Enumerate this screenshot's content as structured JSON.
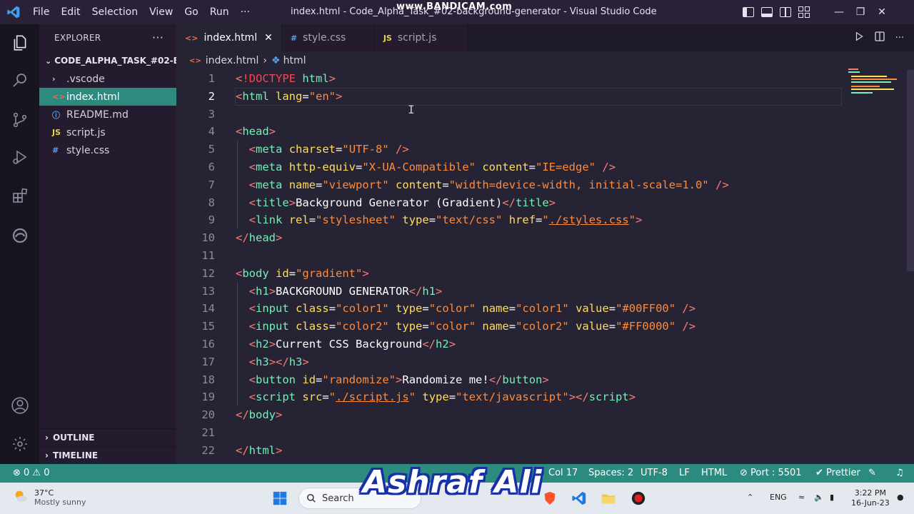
{
  "window": {
    "title": "index.html - Code_Alpha_Task_#02-background-generator - Visual Studio Code",
    "menu": [
      "File",
      "Edit",
      "Selection",
      "View",
      "Go",
      "Run",
      "···"
    ],
    "overlay_text": "www.BANDICAM.com"
  },
  "sidebar": {
    "header": "EXPLORER",
    "project": "CODE_ALPHA_TASK_#02-B...",
    "items": [
      {
        "label": ".vscode",
        "icon": "chevron-right-icon",
        "glyph": "›",
        "color": "#d6d3dc"
      },
      {
        "label": "index.html",
        "icon": "html-file-icon",
        "glyph": "<>",
        "color": "#e8734a"
      },
      {
        "label": "README.md",
        "icon": "info-icon",
        "glyph": "ⓘ",
        "color": "#5aa4e6"
      },
      {
        "label": "script.js",
        "icon": "js-file-icon",
        "glyph": "JS",
        "color": "#e8d44d"
      },
      {
        "label": "style.css",
        "icon": "css-file-icon",
        "glyph": "#",
        "color": "#5aa4e6"
      }
    ],
    "outline": "OUTLINE",
    "timeline": "TIMELINE"
  },
  "tabs": [
    {
      "label": "index.html",
      "icon_glyph": "<>",
      "icon_color": "#e8734a",
      "close": "✕"
    },
    {
      "label": "style.css",
      "icon_glyph": "#",
      "icon_color": "#5aa4e6"
    },
    {
      "label": "script.js",
      "icon_glyph": "JS",
      "icon_color": "#e8d44d"
    }
  ],
  "breadcrumb": {
    "file": "index.html",
    "separator": "›",
    "node": "html"
  },
  "editor": {
    "current_line": 2,
    "lines": [
      {
        "n": "1",
        "tokens": [
          [
            "br",
            "<"
          ],
          [
            "doc",
            "!DOCTYPE"
          ],
          [
            "txt",
            " "
          ],
          [
            "tag",
            "html"
          ],
          [
            "br",
            ">"
          ]
        ]
      },
      {
        "n": "2",
        "tokens": [
          [
            "br",
            "<"
          ],
          [
            "tag",
            "html"
          ],
          [
            "txt",
            " "
          ],
          [
            "attr",
            "lang"
          ],
          [
            "txt",
            "="
          ],
          [
            "str",
            "\"en\""
          ],
          [
            "br",
            ">"
          ]
        ]
      },
      {
        "n": "3",
        "tokens": []
      },
      {
        "n": "4",
        "tokens": [
          [
            "br",
            "<"
          ],
          [
            "tag",
            "head"
          ],
          [
            "br",
            ">"
          ]
        ]
      },
      {
        "n": "5",
        "tokens": [
          [
            "txt",
            "  "
          ],
          [
            "br",
            "<"
          ],
          [
            "tag",
            "meta"
          ],
          [
            "txt",
            " "
          ],
          [
            "attr",
            "charset"
          ],
          [
            "txt",
            "="
          ],
          [
            "str",
            "\"UTF-8\""
          ],
          [
            "txt",
            " "
          ],
          [
            "br",
            "/>"
          ]
        ]
      },
      {
        "n": "6",
        "tokens": [
          [
            "txt",
            "  "
          ],
          [
            "br",
            "<"
          ],
          [
            "tag",
            "meta"
          ],
          [
            "txt",
            " "
          ],
          [
            "attr",
            "http-equiv"
          ],
          [
            "txt",
            "="
          ],
          [
            "str",
            "\"X-UA-Compatible\""
          ],
          [
            "txt",
            " "
          ],
          [
            "attr",
            "content"
          ],
          [
            "txt",
            "="
          ],
          [
            "str",
            "\"IE=edge\""
          ],
          [
            "txt",
            " "
          ],
          [
            "br",
            "/>"
          ]
        ]
      },
      {
        "n": "7",
        "tokens": [
          [
            "txt",
            "  "
          ],
          [
            "br",
            "<"
          ],
          [
            "tag",
            "meta"
          ],
          [
            "txt",
            " "
          ],
          [
            "attr",
            "name"
          ],
          [
            "txt",
            "="
          ],
          [
            "str",
            "\"viewport\""
          ],
          [
            "txt",
            " "
          ],
          [
            "attr",
            "content"
          ],
          [
            "txt",
            "="
          ],
          [
            "str",
            "\"width=device-width, initial-scale=1.0\""
          ],
          [
            "txt",
            " "
          ],
          [
            "br",
            "/>"
          ]
        ]
      },
      {
        "n": "8",
        "tokens": [
          [
            "txt",
            "  "
          ],
          [
            "br",
            "<"
          ],
          [
            "tag",
            "title"
          ],
          [
            "br",
            ">"
          ],
          [
            "txt",
            "Background Generator (Gradient)"
          ],
          [
            "br",
            "</"
          ],
          [
            "tag",
            "title"
          ],
          [
            "br",
            ">"
          ]
        ]
      },
      {
        "n": "9",
        "tokens": [
          [
            "txt",
            "  "
          ],
          [
            "br",
            "<"
          ],
          [
            "tag",
            "link"
          ],
          [
            "txt",
            " "
          ],
          [
            "attr",
            "rel"
          ],
          [
            "txt",
            "="
          ],
          [
            "str",
            "\"stylesheet\""
          ],
          [
            "txt",
            " "
          ],
          [
            "attr",
            "type"
          ],
          [
            "txt",
            "="
          ],
          [
            "str",
            "\"text/css\""
          ],
          [
            "txt",
            " "
          ],
          [
            "attr",
            "href"
          ],
          [
            "txt",
            "="
          ],
          [
            "str",
            "\""
          ],
          [
            "stru",
            "./styles.css"
          ],
          [
            "str",
            "\""
          ],
          [
            "br",
            ">"
          ]
        ]
      },
      {
        "n": "10",
        "tokens": [
          [
            "br",
            "</"
          ],
          [
            "tag",
            "head"
          ],
          [
            "br",
            ">"
          ]
        ]
      },
      {
        "n": "11",
        "tokens": []
      },
      {
        "n": "12",
        "tokens": [
          [
            "br",
            "<"
          ],
          [
            "tag",
            "body"
          ],
          [
            "txt",
            " "
          ],
          [
            "attr",
            "id"
          ],
          [
            "txt",
            "="
          ],
          [
            "str",
            "\"gradient\""
          ],
          [
            "br",
            ">"
          ]
        ]
      },
      {
        "n": "13",
        "tokens": [
          [
            "txt",
            "  "
          ],
          [
            "br",
            "<"
          ],
          [
            "tag",
            "h1"
          ],
          [
            "br",
            ">"
          ],
          [
            "txt",
            "BACKGROUND GENERATOR"
          ],
          [
            "br",
            "</"
          ],
          [
            "tag",
            "h1"
          ],
          [
            "br",
            ">"
          ]
        ]
      },
      {
        "n": "14",
        "tokens": [
          [
            "txt",
            "  "
          ],
          [
            "br",
            "<"
          ],
          [
            "tag",
            "input"
          ],
          [
            "txt",
            " "
          ],
          [
            "attr",
            "class"
          ],
          [
            "txt",
            "="
          ],
          [
            "str",
            "\"color1\""
          ],
          [
            "txt",
            " "
          ],
          [
            "attr",
            "type"
          ],
          [
            "txt",
            "="
          ],
          [
            "str",
            "\"color\""
          ],
          [
            "txt",
            " "
          ],
          [
            "attr",
            "name"
          ],
          [
            "txt",
            "="
          ],
          [
            "str",
            "\"color1\""
          ],
          [
            "txt",
            " "
          ],
          [
            "attr",
            "value"
          ],
          [
            "txt",
            "="
          ],
          [
            "str",
            "\"#00FF00\""
          ],
          [
            "txt",
            " "
          ],
          [
            "br",
            "/>"
          ]
        ]
      },
      {
        "n": "15",
        "tokens": [
          [
            "txt",
            "  "
          ],
          [
            "br",
            "<"
          ],
          [
            "tag",
            "input"
          ],
          [
            "txt",
            " "
          ],
          [
            "attr",
            "class"
          ],
          [
            "txt",
            "="
          ],
          [
            "str",
            "\"color2\""
          ],
          [
            "txt",
            " "
          ],
          [
            "attr",
            "type"
          ],
          [
            "txt",
            "="
          ],
          [
            "str",
            "\"color\""
          ],
          [
            "txt",
            " "
          ],
          [
            "attr",
            "name"
          ],
          [
            "txt",
            "="
          ],
          [
            "str",
            "\"color2\""
          ],
          [
            "txt",
            " "
          ],
          [
            "attr",
            "value"
          ],
          [
            "txt",
            "="
          ],
          [
            "str",
            "\"#FF0000\""
          ],
          [
            "txt",
            " "
          ],
          [
            "br",
            "/>"
          ]
        ]
      },
      {
        "n": "16",
        "tokens": [
          [
            "txt",
            "  "
          ],
          [
            "br",
            "<"
          ],
          [
            "tag",
            "h2"
          ],
          [
            "br",
            ">"
          ],
          [
            "txt",
            "Current CSS Background"
          ],
          [
            "br",
            "</"
          ],
          [
            "tag",
            "h2"
          ],
          [
            "br",
            ">"
          ]
        ]
      },
      {
        "n": "17",
        "tokens": [
          [
            "txt",
            "  "
          ],
          [
            "br",
            "<"
          ],
          [
            "tag",
            "h3"
          ],
          [
            "br",
            "></"
          ],
          [
            "tag",
            "h3"
          ],
          [
            "br",
            ">"
          ]
        ]
      },
      {
        "n": "18",
        "tokens": [
          [
            "txt",
            "  "
          ],
          [
            "br",
            "<"
          ],
          [
            "tag",
            "button"
          ],
          [
            "txt",
            " "
          ],
          [
            "attr",
            "id"
          ],
          [
            "txt",
            "="
          ],
          [
            "str",
            "\"randomize\""
          ],
          [
            "br",
            ">"
          ],
          [
            "txt",
            "Randomize me!"
          ],
          [
            "br",
            "</"
          ],
          [
            "tag",
            "button"
          ],
          [
            "br",
            ">"
          ]
        ]
      },
      {
        "n": "19",
        "tokens": [
          [
            "txt",
            "  "
          ],
          [
            "br",
            "<"
          ],
          [
            "tag",
            "script"
          ],
          [
            "txt",
            " "
          ],
          [
            "attr",
            "src"
          ],
          [
            "txt",
            "="
          ],
          [
            "str",
            "\""
          ],
          [
            "stru",
            "./script.js"
          ],
          [
            "str",
            "\""
          ],
          [
            "txt",
            " "
          ],
          [
            "attr",
            "type"
          ],
          [
            "txt",
            "="
          ],
          [
            "str",
            "\"text/javascript\""
          ],
          [
            "br",
            "></"
          ],
          [
            "tag",
            "script"
          ],
          [
            "br",
            ">"
          ]
        ]
      },
      {
        "n": "20",
        "tokens": [
          [
            "br",
            "</"
          ],
          [
            "tag",
            "body"
          ],
          [
            "br",
            ">"
          ]
        ]
      },
      {
        "n": "21",
        "tokens": []
      },
      {
        "n": "22",
        "tokens": [
          [
            "br",
            "</"
          ],
          [
            "tag",
            "html"
          ],
          [
            "br",
            ">"
          ]
        ]
      }
    ]
  },
  "statusbar": {
    "problems": "⊗ 0 ⚠ 0",
    "position": "Col 17",
    "spaces": "Spaces: 2",
    "encoding": "UTF-8",
    "eol": "LF",
    "language": "HTML",
    "port": "⊘ Port : 5501",
    "prettier": "✔ Prettier"
  },
  "taskbar": {
    "temperature": "37°C",
    "weather": "Mostly sunny",
    "search": "Search",
    "language": "ENG",
    "time": "3:22 PM",
    "date": "16-Jun-23"
  },
  "watermark": "Ashraf Ali",
  "colors": {
    "accent": "#2d8a7f",
    "editor_bg": "#262335",
    "tag": "#72f1b8",
    "attribute": "#fede5d",
    "string": "#ff8b39",
    "bracket": "#f97e72"
  }
}
